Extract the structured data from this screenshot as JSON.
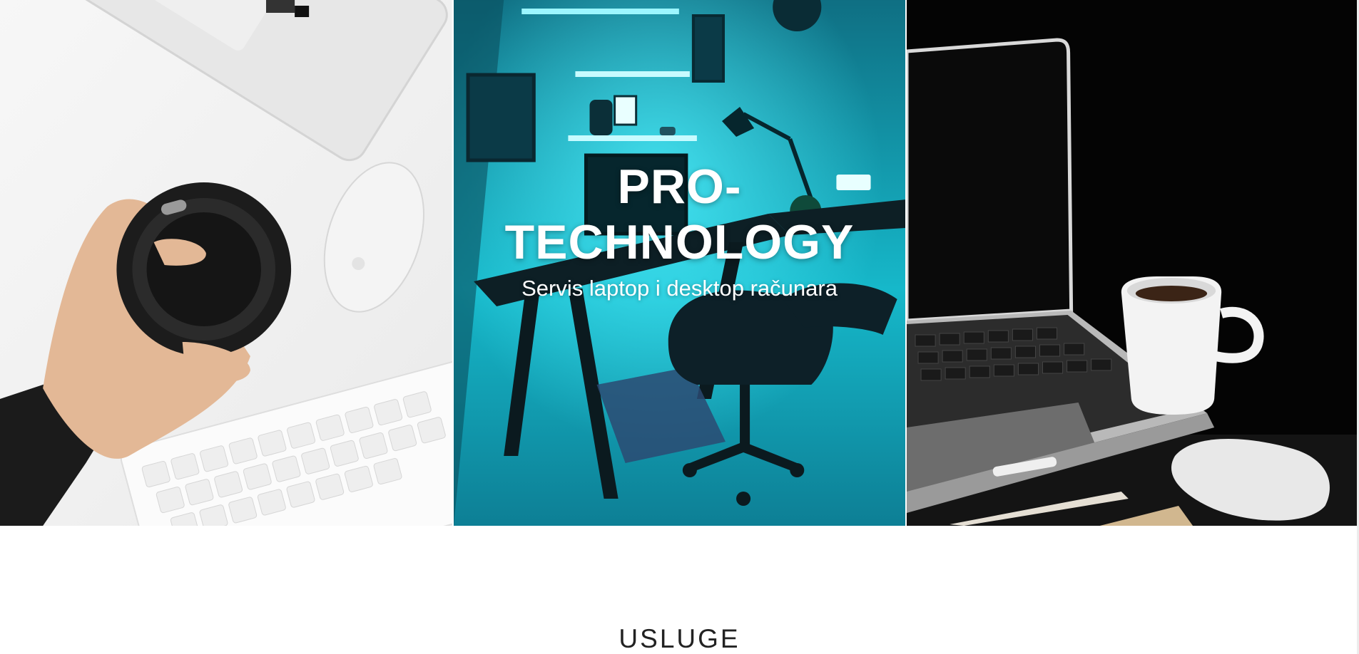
{
  "hero": {
    "title": "PRO-TECHNOLOGY",
    "subtitle": "Servis laptop i desktop računara",
    "panels": [
      {
        "name": "white-desk-coffee-photo"
      },
      {
        "name": "cyan-workspace-photo"
      },
      {
        "name": "dark-laptop-coffee-photo"
      }
    ]
  },
  "services": {
    "heading": "USLUGE"
  },
  "colors": {
    "background": "#ffffff",
    "accent_cyan": "#18b7c9",
    "dark": "#050505",
    "text_dark": "#222222"
  }
}
